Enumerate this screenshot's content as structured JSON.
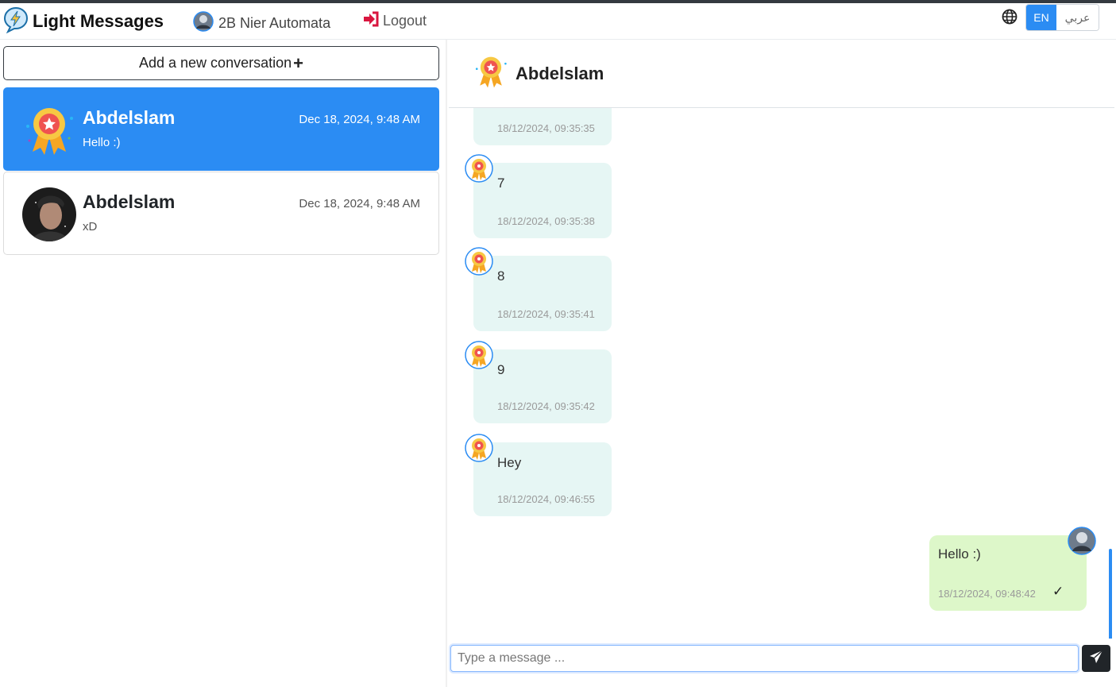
{
  "navbar": {
    "brand": "Light Messages",
    "user_name": "2B Nier Automata",
    "logout_label": "Logout",
    "lang_en": "EN",
    "lang_ar": "عربي"
  },
  "sidebar": {
    "add_label": "Add a new conversation",
    "conversations": [
      {
        "name": "Abdelslam",
        "date": "Dec 18, 2024, 9:48 AM",
        "preview": "Hello :)"
      },
      {
        "name": "Abdelslam",
        "date": "Dec 18, 2024, 9:48 AM",
        "preview": "xD"
      }
    ]
  },
  "chat": {
    "title": "Abdelslam",
    "messages": [
      {
        "text": "",
        "time": "18/12/2024, 09:35:35"
      },
      {
        "text": "7",
        "time": "18/12/2024, 09:35:38"
      },
      {
        "text": "8",
        "time": "18/12/2024, 09:35:41"
      },
      {
        "text": "9",
        "time": "18/12/2024, 09:35:42"
      },
      {
        "text": "Hey",
        "time": "18/12/2024, 09:46:55"
      }
    ],
    "sent": {
      "text": "Hello :)",
      "time": "18/12/2024, 09:48:42",
      "status": "✓"
    },
    "input_placeholder": "Type a message ..."
  },
  "colors": {
    "accent": "#2b8cf3",
    "incoming": "#e6f6f4",
    "outgoing": "#ddf7c9"
  },
  "icons": [
    "lightning-logo-icon",
    "user-avatar-icon",
    "logout-icon",
    "globe-icon",
    "plus-icon",
    "award-badge-icon",
    "send-icon"
  ]
}
